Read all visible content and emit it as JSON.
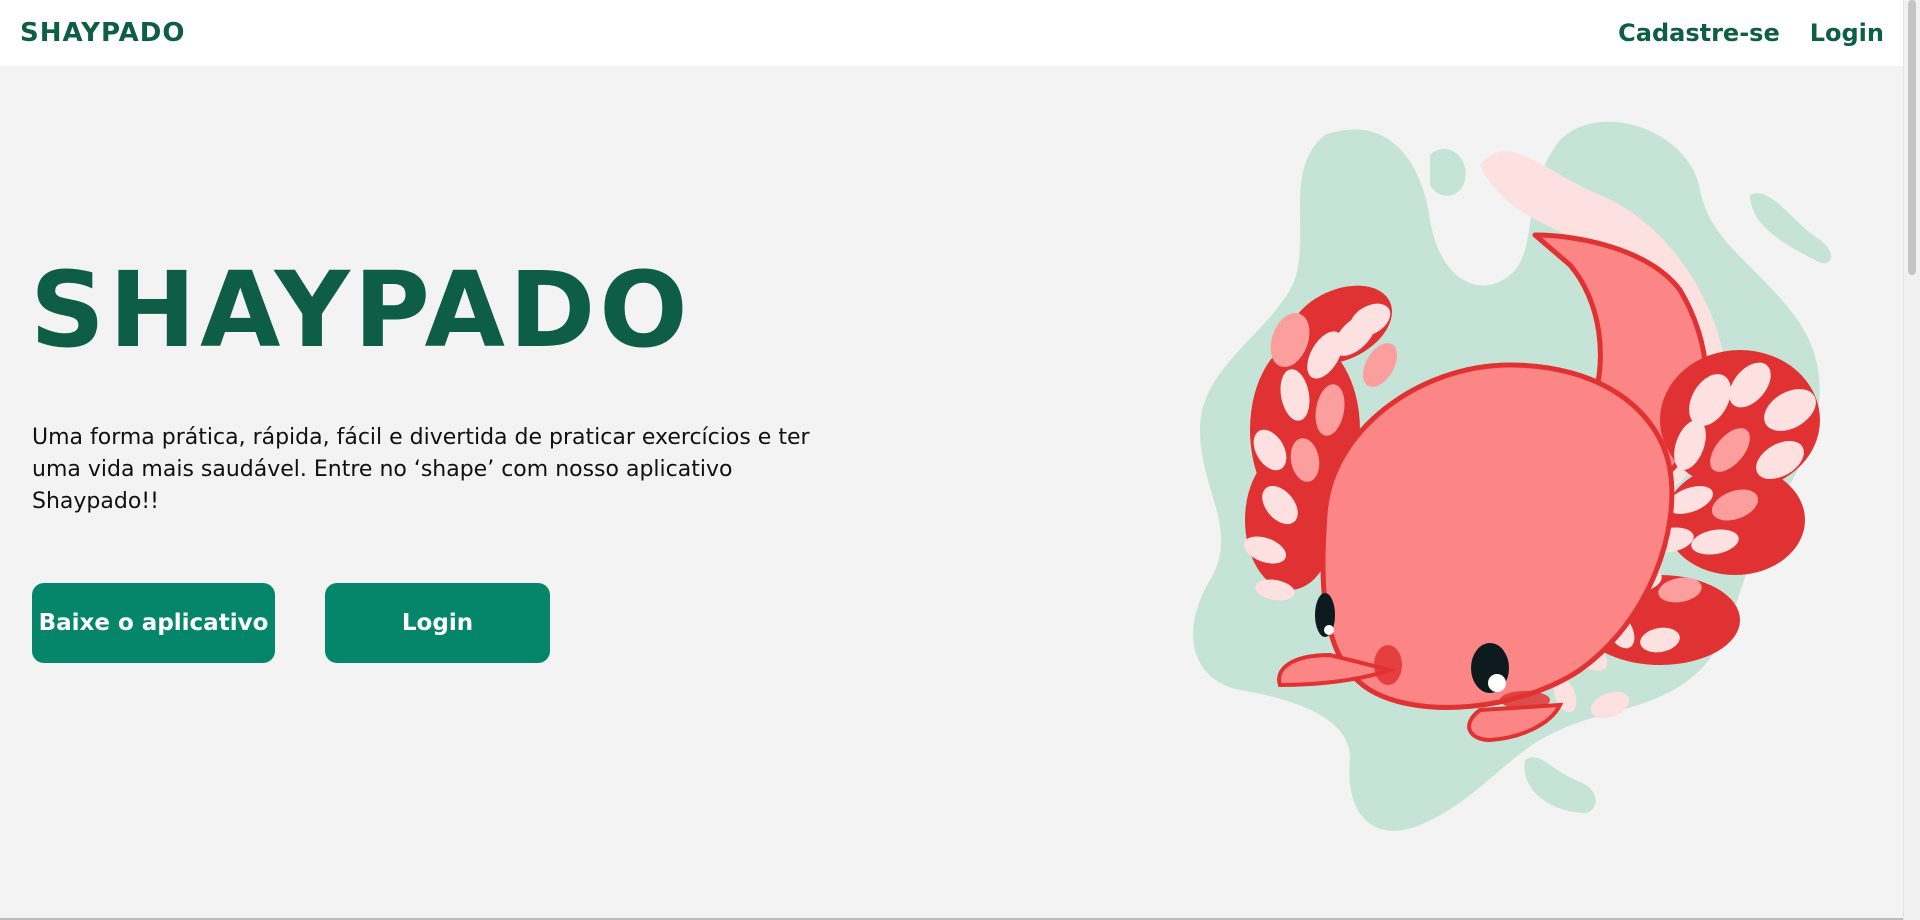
{
  "header": {
    "brand": "SHAYPADO",
    "nav": {
      "signup": "Cadastre-se",
      "login": "Login"
    }
  },
  "hero": {
    "title": "SHAYPADO",
    "description": "Uma forma prática, rápida, fácil e divertida de praticar exercícios e ter uma vida mais saudável. Entre no ‘shape’ com nosso aplicativo Shaypado!!",
    "buttons": {
      "download": "Baixe o aplicativo",
      "login": "Login"
    },
    "illustration": "axolotl-illustration"
  },
  "colors": {
    "brand": "#0e5e45",
    "button": "#05866a",
    "background": "#f3f3f3",
    "blob": "#c5e4d7",
    "axolotl_body": "#fc8585",
    "axolotl_outline": "#e03232"
  }
}
